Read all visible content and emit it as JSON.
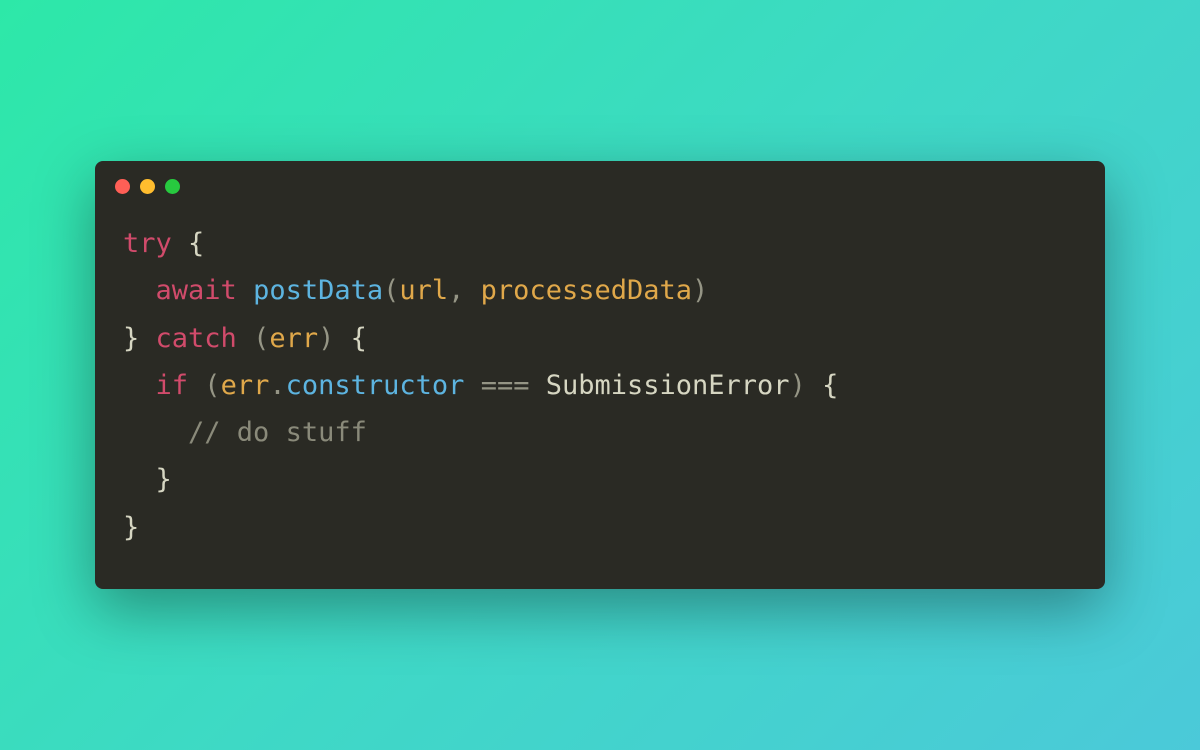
{
  "window": {
    "traffic_lights": [
      "close",
      "minimize",
      "maximize"
    ]
  },
  "code": {
    "lines": [
      {
        "tokens": [
          {
            "cls": "tok-keyword",
            "t": "try"
          },
          {
            "cls": "tok-brace",
            "t": " {"
          }
        ]
      },
      {
        "tokens": [
          {
            "cls": "",
            "t": "  "
          },
          {
            "cls": "tok-keyword",
            "t": "await"
          },
          {
            "cls": "",
            "t": " "
          },
          {
            "cls": "tok-func",
            "t": "postData"
          },
          {
            "cls": "tok-punc",
            "t": "("
          },
          {
            "cls": "tok-param",
            "t": "url"
          },
          {
            "cls": "tok-punc",
            "t": ", "
          },
          {
            "cls": "tok-param",
            "t": "processedData"
          },
          {
            "cls": "tok-punc",
            "t": ")"
          }
        ]
      },
      {
        "tokens": [
          {
            "cls": "tok-brace",
            "t": "}"
          },
          {
            "cls": "",
            "t": " "
          },
          {
            "cls": "tok-keyword",
            "t": "catch"
          },
          {
            "cls": "",
            "t": " "
          },
          {
            "cls": "tok-punc",
            "t": "("
          },
          {
            "cls": "tok-param",
            "t": "err"
          },
          {
            "cls": "tok-punc",
            "t": ")"
          },
          {
            "cls": "tok-brace",
            "t": " {"
          }
        ]
      },
      {
        "tokens": [
          {
            "cls": "",
            "t": "  "
          },
          {
            "cls": "tok-keyword",
            "t": "if"
          },
          {
            "cls": "",
            "t": " "
          },
          {
            "cls": "tok-punc",
            "t": "("
          },
          {
            "cls": "tok-param",
            "t": "err"
          },
          {
            "cls": "tok-punc",
            "t": "."
          },
          {
            "cls": "tok-prop",
            "t": "constructor"
          },
          {
            "cls": "",
            "t": " "
          },
          {
            "cls": "tok-op",
            "t": "==="
          },
          {
            "cls": "",
            "t": " "
          },
          {
            "cls": "tok-type",
            "t": "SubmissionError"
          },
          {
            "cls": "tok-punc",
            "t": ")"
          },
          {
            "cls": "tok-brace",
            "t": " {"
          }
        ]
      },
      {
        "tokens": [
          {
            "cls": "",
            "t": "    "
          },
          {
            "cls": "tok-comment",
            "t": "// do stuff"
          }
        ]
      },
      {
        "tokens": [
          {
            "cls": "",
            "t": "  "
          },
          {
            "cls": "tok-brace",
            "t": "}"
          }
        ]
      },
      {
        "tokens": [
          {
            "cls": "tok-brace",
            "t": "}"
          }
        ]
      }
    ]
  }
}
